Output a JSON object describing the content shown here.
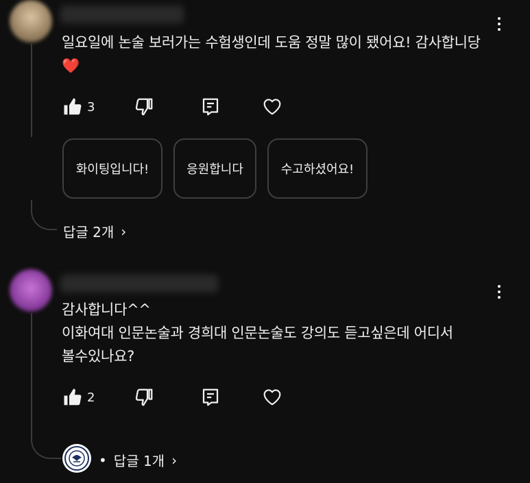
{
  "comments": [
    {
      "text": "일요일에 논술 보러가는 수험생인데 도움 정말 많이 됐어요! 감사합니당\n❤️",
      "likes": "3",
      "suggested_replies": [
        "화이팅입니다!",
        "응원합니다",
        "수고하셨어요!"
      ],
      "replies_label": "답글 2개"
    },
    {
      "text": "감사합니다^^\n이화여대 인문논술과 경희대 인문논술도 강의도 듣고싶은데 어디서\n볼수있나요?",
      "likes": "2",
      "replies_label": "답글 1개",
      "bullet": "•"
    }
  ],
  "icons": {
    "like": "thumbs-up-icon",
    "dislike": "thumbs-down-icon",
    "reply": "reply-icon",
    "heart": "heart-icon",
    "more": "more-vert-icon",
    "chevron": "chevron-right-icon"
  },
  "glyphs": {
    "chevron": "›"
  }
}
